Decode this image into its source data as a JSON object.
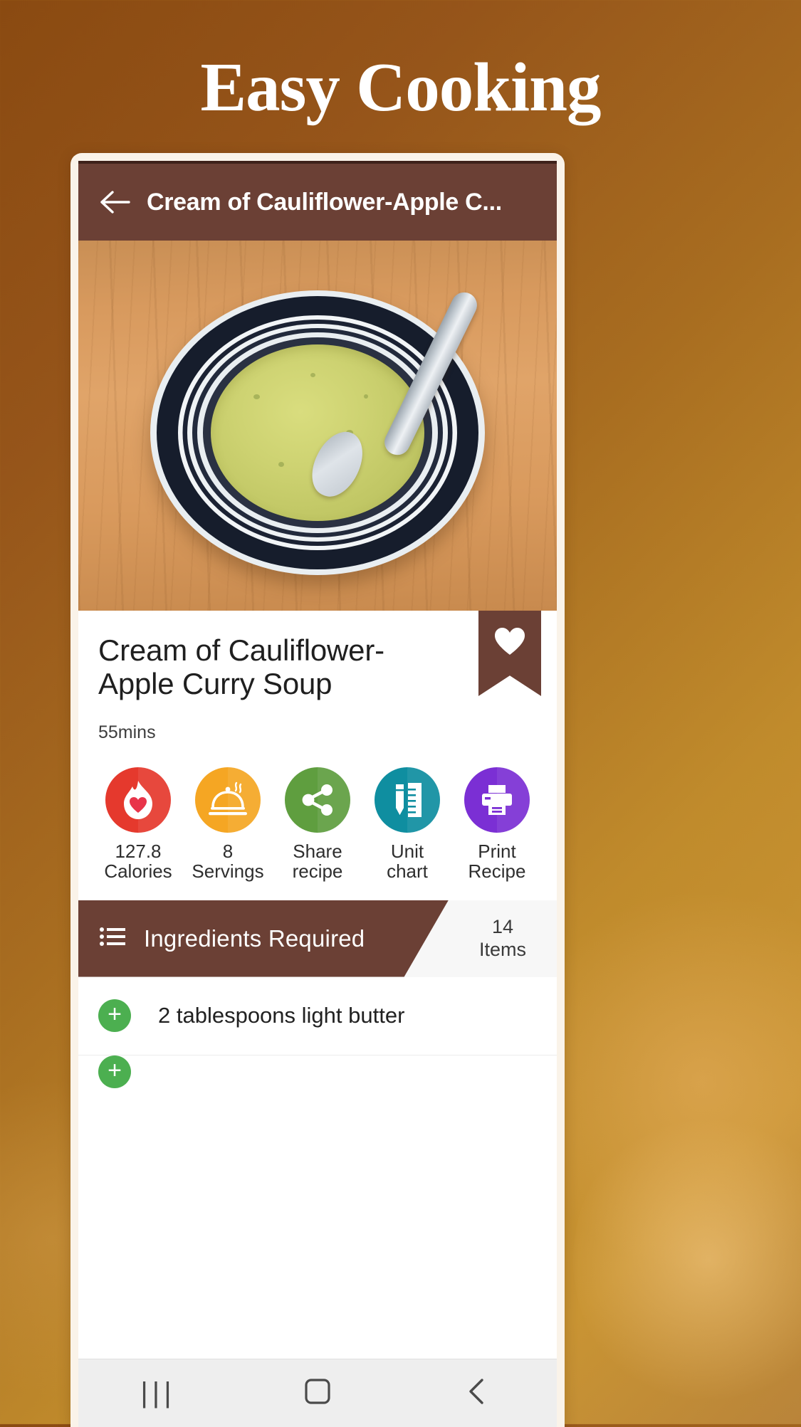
{
  "headline": "Easy Cooking",
  "appbar": {
    "back_icon": "arrow-left-icon",
    "title": "Cream of Cauliflower-Apple C..."
  },
  "hero": {
    "image_alt": "bowl of cream of cauliflower apple curry soup with spoon on wooden table"
  },
  "recipe": {
    "title": "Cream of Cauliflower-Apple Curry Soup",
    "duration": "55mins",
    "bookmark_icon": "heart-icon"
  },
  "actions": [
    {
      "icon": "flame-heart-icon",
      "value": "127.8",
      "unit": "Calories",
      "color": "#e5392d"
    },
    {
      "icon": "cloche-icon",
      "value": "8",
      "unit": "Servings",
      "color": "#f5a623"
    },
    {
      "icon": "share-icon",
      "value": "Share",
      "unit": "recipe",
      "color": "#5f9e3f"
    },
    {
      "icon": "ruler-pencil-icon",
      "value": "Unit",
      "unit": "chart",
      "color": "#0f8ea0"
    },
    {
      "icon": "printer-icon",
      "value": "Print",
      "unit": "Recipe",
      "color": "#7b2fd4"
    }
  ],
  "ingredients_header": {
    "icon": "list-icon",
    "label": "Ingredients Required",
    "count": "14",
    "count_unit": "Items"
  },
  "ingredients": [
    {
      "add_icon": "plus-icon",
      "text": "2 tablespoons light butter"
    }
  ],
  "navbar": {
    "recents": "|||",
    "home_icon": "home-square-icon",
    "back_icon": "chevron-left-icon"
  },
  "colors": {
    "brand_brown": "#6b4035",
    "appbar_top_line": "#3e211a",
    "phone_frame": "#faf3e9",
    "add_green": "#4caf50"
  }
}
